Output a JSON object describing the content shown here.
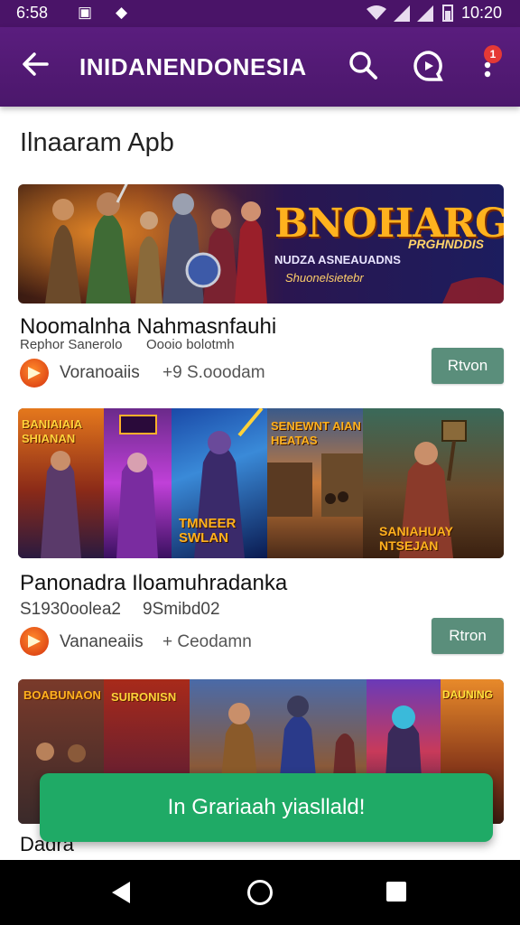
{
  "status_bar": {
    "time": "6:58",
    "right_time": "10:20"
  },
  "app_bar": {
    "title": "INIDANENDONESIA",
    "badge": "1"
  },
  "section": {
    "title": "Ilnaaram Apb"
  },
  "cards": [
    {
      "banner_text": "BNOHARGHN",
      "banner_sub1": "PRGHNDDIS",
      "banner_sub2": "NUDZA ASNEAUADNS",
      "banner_sub3": "Shuonelsietebr",
      "title": "Noomalnha Nahmasnfauhi",
      "meta_left": "Rephor Sanerolo",
      "meta_right": "Oooio bolotmh",
      "developer": "Voranoaiis",
      "downloads": "+9 S.ooodam",
      "button": "Rtvon"
    },
    {
      "tiles": [
        "BANIAIAIA SHIANAN",
        "",
        "TMNEER SWLAN",
        "SENEWNT AIAN HEATAS",
        "SANIAHUAY NTSEJAN"
      ],
      "title": "Panonadra Iloamuhradanka",
      "meta_left": "S1930oolea2",
      "meta_right": "9Smibd02",
      "developer": "Vananeaiis",
      "downloads": "+ Ceodamn",
      "button": "Rtron"
    },
    {
      "tiles": [
        "BOABUNAON",
        "SUIRONISN",
        "",
        "",
        "",
        "DAUNING"
      ],
      "title": "Dadra"
    }
  ],
  "toast": {
    "message": "In Grariaah yiasllald!"
  }
}
